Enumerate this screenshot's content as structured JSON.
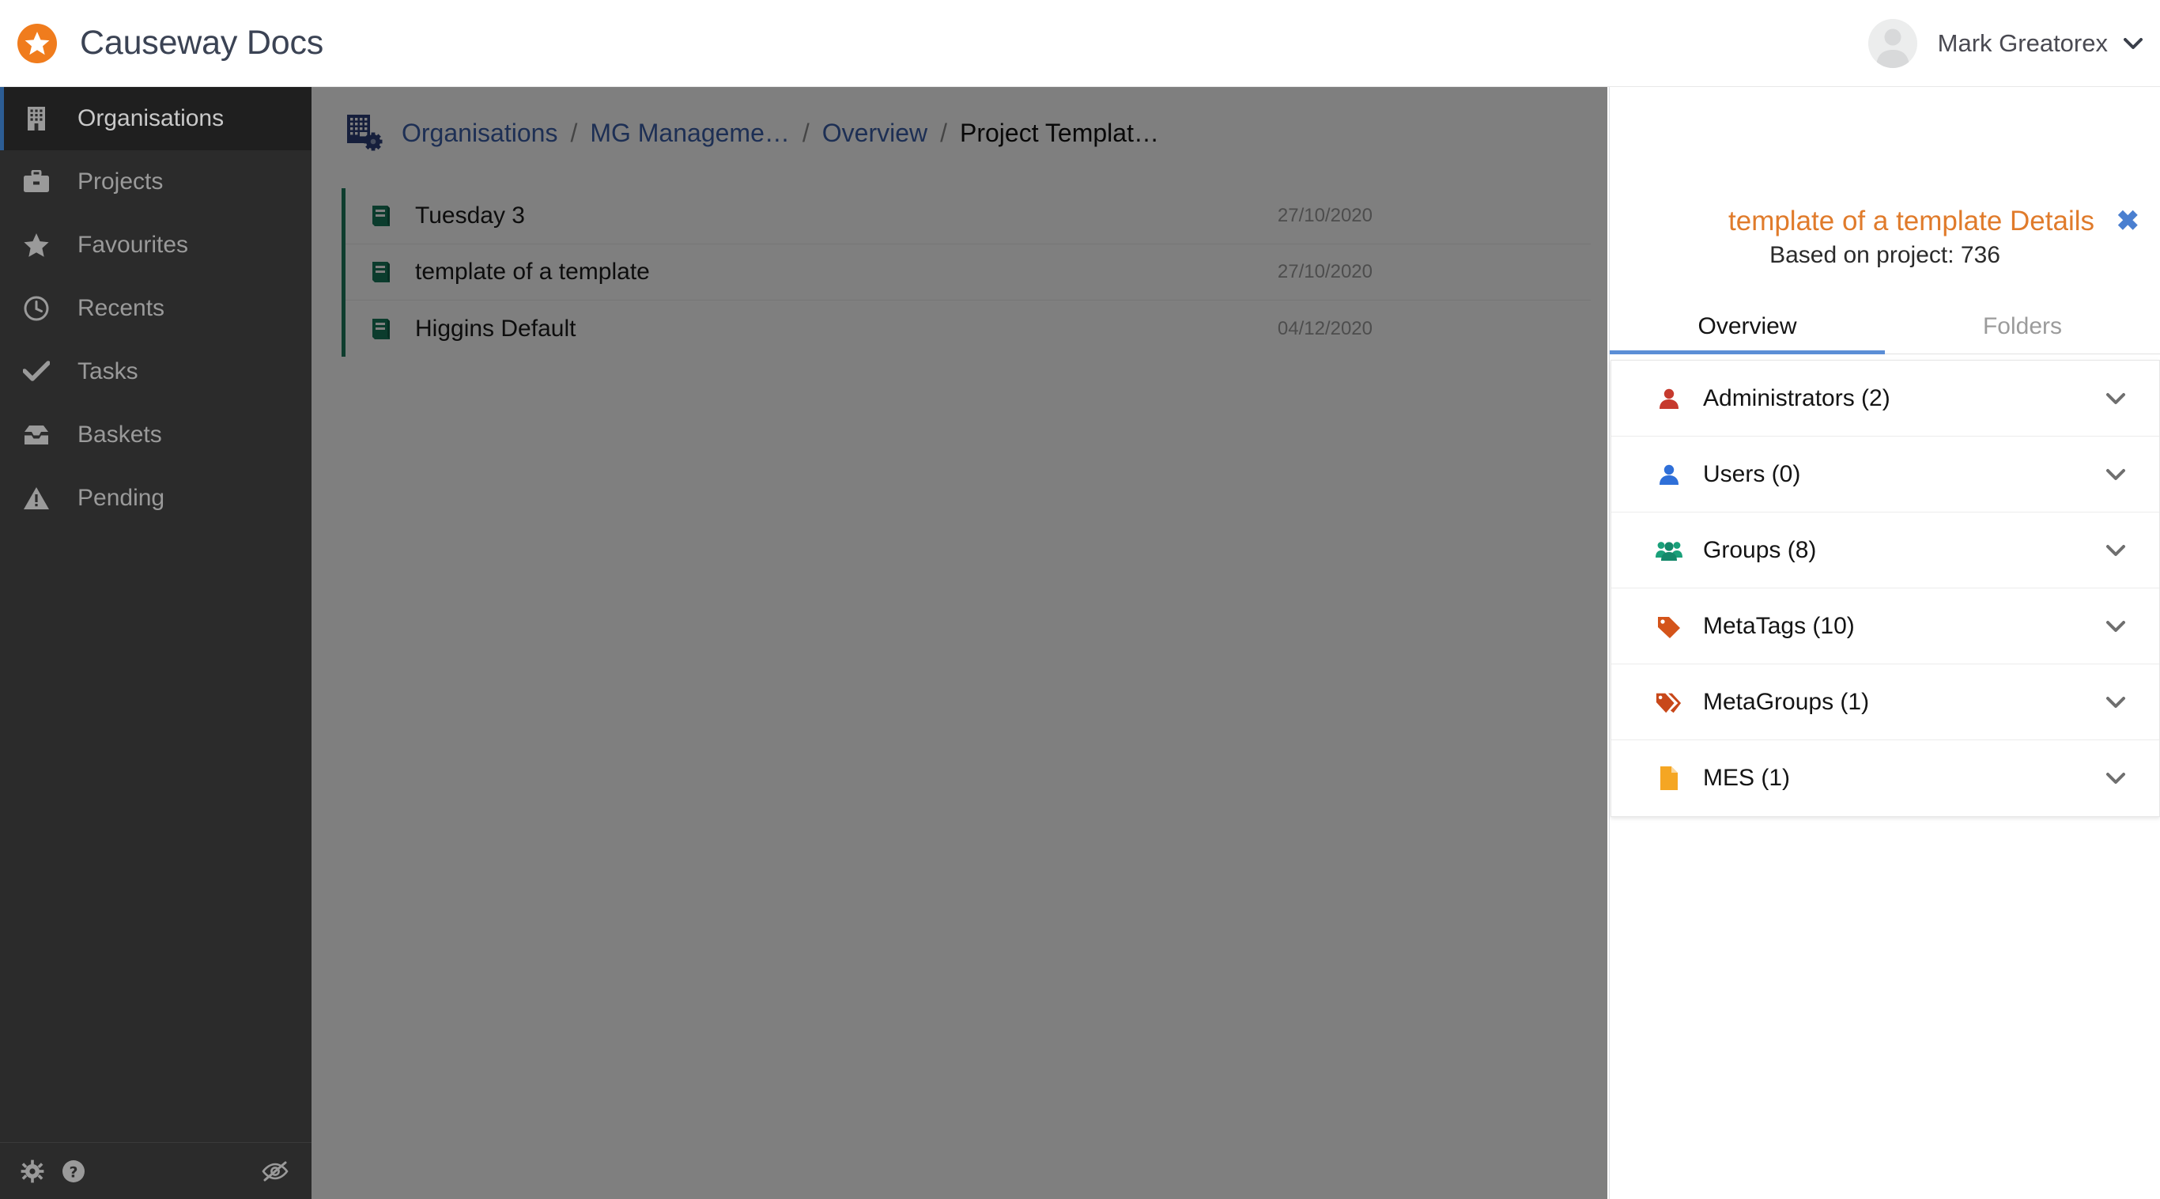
{
  "app": {
    "brand_title": "Causeway Docs",
    "logo_icon": "star-circle-logo"
  },
  "user": {
    "name": "Mark Greatorex",
    "avatar_icon": "avatar-placeholder-icon",
    "caret_icon": "chevron-down-icon"
  },
  "sidebar": {
    "items": [
      {
        "label": "Organisations",
        "icon": "building-icon",
        "active": true
      },
      {
        "label": "Projects",
        "icon": "briefcase-icon",
        "active": false
      },
      {
        "label": "Favourites",
        "icon": "star-icon",
        "active": false
      },
      {
        "label": "Recents",
        "icon": "clock-icon",
        "active": false
      },
      {
        "label": "Tasks",
        "icon": "check-icon",
        "active": false
      },
      {
        "label": "Baskets",
        "icon": "inbox-icon",
        "active": false
      },
      {
        "label": "Pending",
        "icon": "warning-triangle-icon",
        "active": false
      }
    ],
    "footer": {
      "settings_icon": "gear-icon",
      "help_icon": "question-circle-icon",
      "hide_icon": "eye-slash-icon"
    },
    "active_accent_color": "#2c5d94"
  },
  "breadcrumb": {
    "icon": "building-gear-icon",
    "items": [
      {
        "label": "Organisations",
        "current": false
      },
      {
        "label": "MG Manageme…",
        "current": false
      },
      {
        "label": "Overview",
        "current": false
      },
      {
        "label": "Project Templat…",
        "current": true
      }
    ],
    "separator": "/",
    "link_color": "#3a5ea8"
  },
  "document_list": {
    "accent_color": "#1d7a5c",
    "row_icon": "book-icon",
    "rows": [
      {
        "name": "Tuesday 3",
        "date": "27/10/2020"
      },
      {
        "name": "template of a template",
        "date": "27/10/2020"
      },
      {
        "name": "Higgins Default",
        "date": "04/12/2020"
      }
    ]
  },
  "details_panel": {
    "title": "template of a template Details",
    "title_color": "#e07b2b",
    "close_icon": "close-icon",
    "close_glyph": "✖",
    "subtitle": "Based on project: 736",
    "tabs": [
      {
        "label": "Overview",
        "active": true
      },
      {
        "label": "Folders",
        "active": false
      }
    ],
    "tab_accent_color": "#5b8ed6",
    "sections": [
      {
        "label": "Administrators (2)",
        "icon": "user-red-icon",
        "color": "#c63a2e",
        "caret": "chevron-down-icon"
      },
      {
        "label": "Users (0)",
        "icon": "user-blue-icon",
        "color": "#2f6fd8",
        "caret": "chevron-down-icon"
      },
      {
        "label": "Groups (8)",
        "icon": "users-group-icon",
        "color": "#1aa07a",
        "caret": "chevron-down-icon"
      },
      {
        "label": "MetaTags (10)",
        "icon": "tag-icon",
        "color": "#d4541a",
        "caret": "chevron-down-icon"
      },
      {
        "label": "MetaGroups (1)",
        "icon": "tags-icon",
        "color": "#c8481a",
        "caret": "chevron-down-icon"
      },
      {
        "label": "MES (1)",
        "icon": "file-icon",
        "color": "#f5a623",
        "caret": "chevron-down-icon"
      }
    ]
  }
}
